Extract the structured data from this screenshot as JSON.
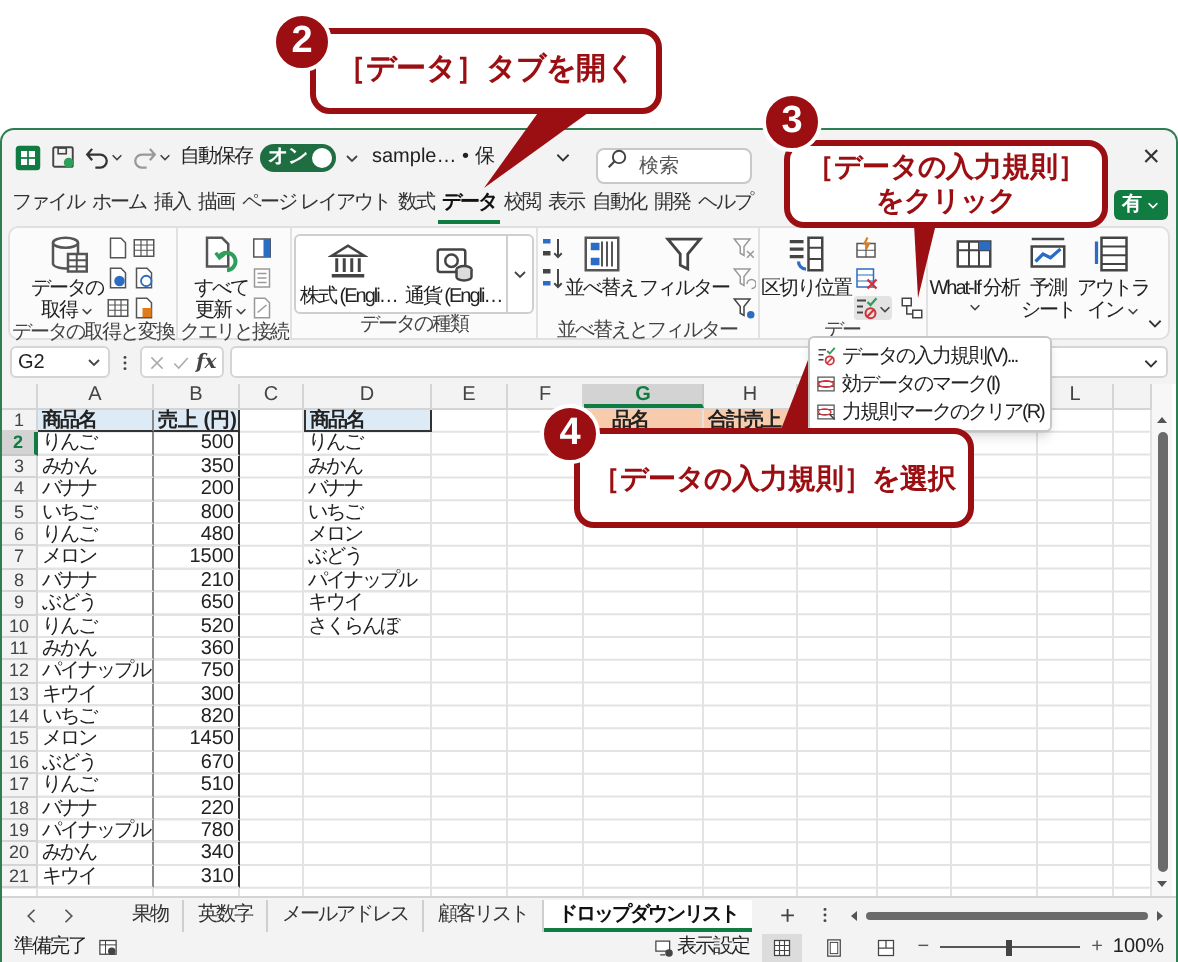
{
  "callouts": [
    {
      "number": "2",
      "text": "［データ］タブを開く"
    },
    {
      "number": "3",
      "text": "［データの入力規則］をクリック"
    },
    {
      "number": "4",
      "text": "［データの入力規則］を選択"
    }
  ],
  "title_bar": {
    "autosave_label": "自動保存",
    "autosave_toggle": {
      "text": "オン",
      "on": true
    },
    "file_name": "sample… • 保",
    "search": {
      "placeholder": "検索"
    },
    "close": "×"
  },
  "menu_tabs": [
    {
      "label": "ファイル",
      "selected": false
    },
    {
      "label": "ホーム",
      "selected": false
    },
    {
      "label": "挿入",
      "selected": false
    },
    {
      "label": "描画",
      "selected": false
    },
    {
      "label": "ページ レイアウト",
      "selected": false
    },
    {
      "label": "数式",
      "selected": false
    },
    {
      "label": "データ",
      "selected": true
    },
    {
      "label": "校閲",
      "selected": false
    },
    {
      "label": "表示",
      "selected": false
    },
    {
      "label": "自動化",
      "selected": false
    },
    {
      "label": "開発",
      "selected": false
    },
    {
      "label": "ヘルプ",
      "selected": false
    }
  ],
  "share_button": {
    "text": "有"
  },
  "ribbon": {
    "groups": [
      {
        "kind": "get_data",
        "label": "データの取得と変換",
        "buttons": [
          {
            "lines": [
              "データの",
              "取得"
            ],
            "dropdown": true
          }
        ]
      },
      {
        "kind": "queries",
        "label": "クエリと接続",
        "buttons": [
          {
            "lines": [
              "すべて",
              "更新"
            ],
            "dropdown": true
          }
        ]
      },
      {
        "kind": "data_types",
        "label": "データの種類",
        "buttons": [
          {
            "lines": [
              "株式 (Engli…"
            ],
            "dropdown": false
          },
          {
            "lines": [
              "通貨 (Engli…"
            ],
            "dropdown": false
          }
        ]
      },
      {
        "kind": "sort_filter",
        "label": "並べ替えとフィルター",
        "buttons": [
          {
            "lines": [
              "並べ替え"
            ],
            "dropdown": false
          },
          {
            "lines": [
              "フィルター"
            ],
            "dropdown": false
          }
        ]
      },
      {
        "kind": "data_tools",
        "label": "デー",
        "buttons": [
          {
            "lines": [
              "区切り位置"
            ],
            "dropdown": false
          }
        ]
      },
      {
        "kind": "forecast",
        "buttons": [
          {
            "lines": [
              "What-If 分析"
            ],
            "dropdown": true
          },
          {
            "lines": [
              "予測",
              "シート"
            ],
            "dropdown": false
          },
          {
            "lines": [
              "アウトラ",
              "イン"
            ],
            "dropdown": true
          }
        ]
      }
    ]
  },
  "dropdown_menu": {
    "items": [
      "データの入力規則(V)...",
      "効データのマーク(I)",
      "力規則マークのクリア(R)"
    ]
  },
  "formula_bar": {
    "name_box": "G2",
    "function_label": "fx"
  },
  "grid": {
    "column_headers": [
      {
        "letter": "A",
        "selected": false
      },
      {
        "letter": "B",
        "selected": false
      },
      {
        "letter": "C",
        "selected": false
      },
      {
        "letter": "D",
        "selected": false
      },
      {
        "letter": "E",
        "selected": false
      },
      {
        "letter": "F",
        "selected": false
      },
      {
        "letter": "G",
        "selected": true
      },
      {
        "letter": "H",
        "selected": false
      },
      {
        "letter": "L",
        "selected": false
      }
    ],
    "header_row": {
      "number": "1",
      "selected": false,
      "a": "商品名",
      "b": "売上 (円)",
      "d": "商品名",
      "g": "品名",
      "h": "合計売上"
    },
    "rows": [
      {
        "number": "2",
        "selected": true,
        "a": "りんご",
        "b": "500",
        "d": "りんご"
      },
      {
        "number": "3",
        "selected": false,
        "a": "みかん",
        "b": "350",
        "d": "みかん"
      },
      {
        "number": "4",
        "selected": false,
        "a": "バナナ",
        "b": "200",
        "d": "バナナ"
      },
      {
        "number": "5",
        "selected": false,
        "a": "いちご",
        "b": "800",
        "d": "いちご"
      },
      {
        "number": "6",
        "selected": false,
        "a": "りんご",
        "b": "480",
        "d": "メロン"
      },
      {
        "number": "7",
        "selected": false,
        "a": "メロン",
        "b": "1500",
        "d": "ぶどう"
      },
      {
        "number": "8",
        "selected": false,
        "a": "バナナ",
        "b": "210",
        "d": "パイナップル"
      },
      {
        "number": "9",
        "selected": false,
        "a": "ぶどう",
        "b": "650",
        "d": "キウイ"
      },
      {
        "number": "10",
        "selected": false,
        "a": "りんご",
        "b": "520",
        "d": "さくらんぼ"
      },
      {
        "number": "11",
        "selected": false,
        "a": "みかん",
        "b": "360"
      },
      {
        "number": "12",
        "selected": false,
        "a": "パイナップル",
        "b": "750"
      },
      {
        "number": "13",
        "selected": false,
        "a": "キウイ",
        "b": "300"
      },
      {
        "number": "14",
        "selected": false,
        "a": "いちご",
        "b": "820"
      },
      {
        "number": "15",
        "selected": false,
        "a": "メロン",
        "b": "1450"
      },
      {
        "number": "16",
        "selected": false,
        "a": "ぶどう",
        "b": "670"
      },
      {
        "number": "17",
        "selected": false,
        "a": "りんご",
        "b": "510"
      },
      {
        "number": "18",
        "selected": false,
        "a": "バナナ",
        "b": "220"
      },
      {
        "number": "19",
        "selected": false,
        "a": "パイナップル",
        "b": "780"
      },
      {
        "number": "20",
        "selected": false,
        "a": "みかん",
        "b": "340"
      },
      {
        "number": "21",
        "selected": false,
        "a": "キウイ",
        "b": "310"
      }
    ]
  },
  "sheet_tabs": [
    {
      "label": "果物",
      "selected": false
    },
    {
      "label": "英数字",
      "selected": false
    },
    {
      "label": "メールアドレス",
      "selected": false
    },
    {
      "label": "顧客リスト",
      "selected": false
    },
    {
      "label": "ドロップダウンリスト",
      "selected": true
    }
  ],
  "add_sheet": "+",
  "status_bar": {
    "ready": "準備完了",
    "display_settings": "表示設定",
    "views": [
      {
        "selected": true
      },
      {
        "selected": false
      },
      {
        "selected": false
      }
    ],
    "zoom_out": "−",
    "zoom_in": "+",
    "zoom": {
      "level": 0.5,
      "text": "100%"
    }
  }
}
